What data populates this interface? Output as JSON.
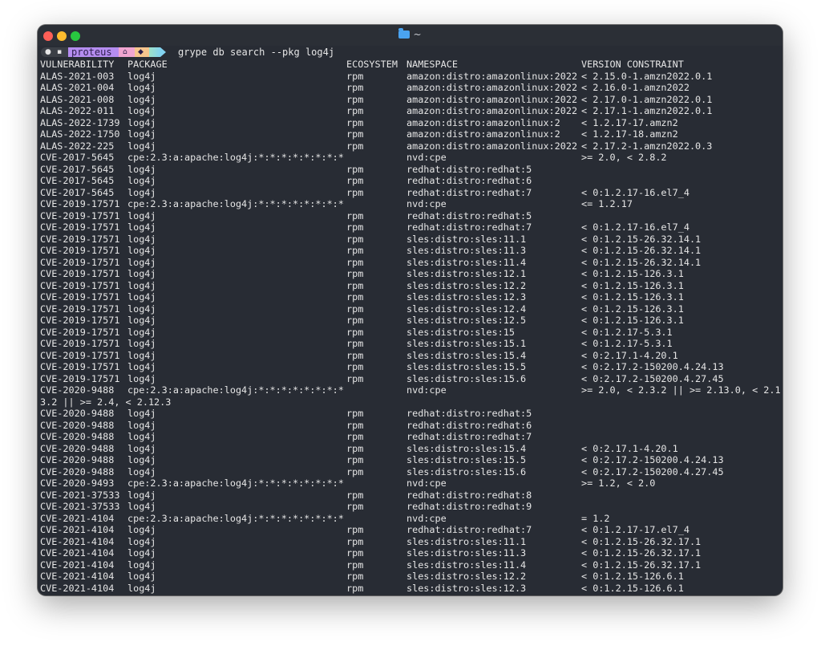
{
  "window": {
    "title": "~",
    "traffic_lights": [
      "close",
      "minimize",
      "zoom"
    ],
    "colors": {
      "background": "#282c34",
      "titlebar": "#2b2f36",
      "text": "#e6e6e6"
    }
  },
  "prompt": {
    "user": "proteus",
    "command": "grype db search --pkg log4j",
    "segment_icons": [
      "apple-icon",
      "terminal-icon",
      "home-icon",
      "git-icon"
    ],
    "segment_colors": [
      "#3b3f46",
      "#b58df0",
      "#f0a5d0",
      "#f6c58d",
      "#82d3f0"
    ]
  },
  "table": {
    "headers": {
      "vulnerability": "VULNERABILITY",
      "package": "PACKAGE",
      "ecosystem": "ECOSYSTEM",
      "namespace": "NAMESPACE",
      "version_constraint": "VERSION CONSTRAINT"
    },
    "rows": [
      {
        "v": "ALAS-2021-003",
        "p": "log4j",
        "e": "rpm",
        "n": "amazon:distro:amazonlinux:2022",
        "r": "< 2.15.0-1.amzn2022.0.1"
      },
      {
        "v": "ALAS-2021-004",
        "p": "log4j",
        "e": "rpm",
        "n": "amazon:distro:amazonlinux:2022",
        "r": "< 2.16.0-1.amzn2022"
      },
      {
        "v": "ALAS-2021-008",
        "p": "log4j",
        "e": "rpm",
        "n": "amazon:distro:amazonlinux:2022",
        "r": "< 2.17.0-1.amzn2022.0.1"
      },
      {
        "v": "ALAS-2022-011",
        "p": "log4j",
        "e": "rpm",
        "n": "amazon:distro:amazonlinux:2022",
        "r": "< 2.17.1-1.amzn2022.0.1"
      },
      {
        "v": "ALAS-2022-1739",
        "p": "log4j",
        "e": "rpm",
        "n": "amazon:distro:amazonlinux:2",
        "r": "< 1.2.17-17.amzn2"
      },
      {
        "v": "ALAS-2022-1750",
        "p": "log4j",
        "e": "rpm",
        "n": "amazon:distro:amazonlinux:2",
        "r": "< 1.2.17-18.amzn2"
      },
      {
        "v": "ALAS-2022-225",
        "p": "log4j",
        "e": "rpm",
        "n": "amazon:distro:amazonlinux:2022",
        "r": "< 2.17.2-1.amzn2022.0.3"
      },
      {
        "v": "CVE-2017-5645",
        "p": "cpe:2.3:a:apache:log4j:*:*:*:*:*:*:*:*",
        "e": "",
        "n": "nvd:cpe",
        "r": ">= 2.0, < 2.8.2"
      },
      {
        "v": "CVE-2017-5645",
        "p": "log4j",
        "e": "rpm",
        "n": "redhat:distro:redhat:5",
        "r": ""
      },
      {
        "v": "CVE-2017-5645",
        "p": "log4j",
        "e": "rpm",
        "n": "redhat:distro:redhat:6",
        "r": ""
      },
      {
        "v": "CVE-2017-5645",
        "p": "log4j",
        "e": "rpm",
        "n": "redhat:distro:redhat:7",
        "r": "< 0:1.2.17-16.el7_4"
      },
      {
        "v": "CVE-2019-17571",
        "p": "cpe:2.3:a:apache:log4j:*:*:*:*:*:*:*:*",
        "e": "",
        "n": "nvd:cpe",
        "r": "<= 1.2.17"
      },
      {
        "v": "CVE-2019-17571",
        "p": "log4j",
        "e": "rpm",
        "n": "redhat:distro:redhat:5",
        "r": ""
      },
      {
        "v": "CVE-2019-17571",
        "p": "log4j",
        "e": "rpm",
        "n": "redhat:distro:redhat:7",
        "r": "< 0:1.2.17-16.el7_4"
      },
      {
        "v": "CVE-2019-17571",
        "p": "log4j",
        "e": "rpm",
        "n": "sles:distro:sles:11.1",
        "r": "< 0:1.2.15-26.32.14.1"
      },
      {
        "v": "CVE-2019-17571",
        "p": "log4j",
        "e": "rpm",
        "n": "sles:distro:sles:11.3",
        "r": "< 0:1.2.15-26.32.14.1"
      },
      {
        "v": "CVE-2019-17571",
        "p": "log4j",
        "e": "rpm",
        "n": "sles:distro:sles:11.4",
        "r": "< 0:1.2.15-26.32.14.1"
      },
      {
        "v": "CVE-2019-17571",
        "p": "log4j",
        "e": "rpm",
        "n": "sles:distro:sles:12.1",
        "r": "< 0:1.2.15-126.3.1"
      },
      {
        "v": "CVE-2019-17571",
        "p": "log4j",
        "e": "rpm",
        "n": "sles:distro:sles:12.2",
        "r": "< 0:1.2.15-126.3.1"
      },
      {
        "v": "CVE-2019-17571",
        "p": "log4j",
        "e": "rpm",
        "n": "sles:distro:sles:12.3",
        "r": "< 0:1.2.15-126.3.1"
      },
      {
        "v": "CVE-2019-17571",
        "p": "log4j",
        "e": "rpm",
        "n": "sles:distro:sles:12.4",
        "r": "< 0:1.2.15-126.3.1"
      },
      {
        "v": "CVE-2019-17571",
        "p": "log4j",
        "e": "rpm",
        "n": "sles:distro:sles:12.5",
        "r": "< 0:1.2.15-126.3.1"
      },
      {
        "v": "CVE-2019-17571",
        "p": "log4j",
        "e": "rpm",
        "n": "sles:distro:sles:15",
        "r": "< 0:1.2.17-5.3.1"
      },
      {
        "v": "CVE-2019-17571",
        "p": "log4j",
        "e": "rpm",
        "n": "sles:distro:sles:15.1",
        "r": "< 0:1.2.17-5.3.1"
      },
      {
        "v": "CVE-2019-17571",
        "p": "log4j",
        "e": "rpm",
        "n": "sles:distro:sles:15.4",
        "r": "< 0:2.17.1-4.20.1"
      },
      {
        "v": "CVE-2019-17571",
        "p": "log4j",
        "e": "rpm",
        "n": "sles:distro:sles:15.5",
        "r": "< 0:2.17.2-150200.4.24.13"
      },
      {
        "v": "CVE-2019-17571",
        "p": "log4j",
        "e": "rpm",
        "n": "sles:distro:sles:15.6",
        "r": "< 0:2.17.2-150200.4.27.45"
      },
      {
        "v": "CVE-2020-9488",
        "p": "cpe:2.3:a:apache:log4j:*:*:*:*:*:*:*:*",
        "e": "",
        "n": "nvd:cpe",
        "r": ">= 2.0, < 2.3.2 || >= 2.13.0, < 2.13.2 || >= 2.4, < 2.12.3"
      },
      {
        "v": "CVE-2020-9488",
        "p": "log4j",
        "e": "rpm",
        "n": "redhat:distro:redhat:5",
        "r": ""
      },
      {
        "v": "CVE-2020-9488",
        "p": "log4j",
        "e": "rpm",
        "n": "redhat:distro:redhat:6",
        "r": ""
      },
      {
        "v": "CVE-2020-9488",
        "p": "log4j",
        "e": "rpm",
        "n": "redhat:distro:redhat:7",
        "r": ""
      },
      {
        "v": "CVE-2020-9488",
        "p": "log4j",
        "e": "rpm",
        "n": "sles:distro:sles:15.4",
        "r": "< 0:2.17.1-4.20.1"
      },
      {
        "v": "CVE-2020-9488",
        "p": "log4j",
        "e": "rpm",
        "n": "sles:distro:sles:15.5",
        "r": "< 0:2.17.2-150200.4.24.13"
      },
      {
        "v": "CVE-2020-9488",
        "p": "log4j",
        "e": "rpm",
        "n": "sles:distro:sles:15.6",
        "r": "< 0:2.17.2-150200.4.27.45"
      },
      {
        "v": "CVE-2020-9493",
        "p": "cpe:2.3:a:apache:log4j:*:*:*:*:*:*:*:*",
        "e": "",
        "n": "nvd:cpe",
        "r": ">= 1.2, < 2.0"
      },
      {
        "v": "CVE-2021-37533",
        "p": "log4j",
        "e": "rpm",
        "n": "redhat:distro:redhat:8",
        "r": ""
      },
      {
        "v": "CVE-2021-37533",
        "p": "log4j",
        "e": "rpm",
        "n": "redhat:distro:redhat:9",
        "r": ""
      },
      {
        "v": "CVE-2021-4104",
        "p": "cpe:2.3:a:apache:log4j:*:*:*:*:*:*:*:*",
        "e": "",
        "n": "nvd:cpe",
        "r": "= 1.2"
      },
      {
        "v": "CVE-2021-4104",
        "p": "log4j",
        "e": "rpm",
        "n": "redhat:distro:redhat:7",
        "r": "< 0:1.2.17-17.el7_4"
      },
      {
        "v": "CVE-2021-4104",
        "p": "log4j",
        "e": "rpm",
        "n": "sles:distro:sles:11.1",
        "r": "< 0:1.2.15-26.32.17.1"
      },
      {
        "v": "CVE-2021-4104",
        "p": "log4j",
        "e": "rpm",
        "n": "sles:distro:sles:11.3",
        "r": "< 0:1.2.15-26.32.17.1"
      },
      {
        "v": "CVE-2021-4104",
        "p": "log4j",
        "e": "rpm",
        "n": "sles:distro:sles:11.4",
        "r": "< 0:1.2.15-26.32.17.1"
      },
      {
        "v": "CVE-2021-4104",
        "p": "log4j",
        "e": "rpm",
        "n": "sles:distro:sles:12.2",
        "r": "< 0:1.2.15-126.6.1"
      },
      {
        "v": "CVE-2021-4104",
        "p": "log4j",
        "e": "rpm",
        "n": "sles:distro:sles:12.3",
        "r": "< 0:1.2.15-126.6.1"
      }
    ]
  }
}
